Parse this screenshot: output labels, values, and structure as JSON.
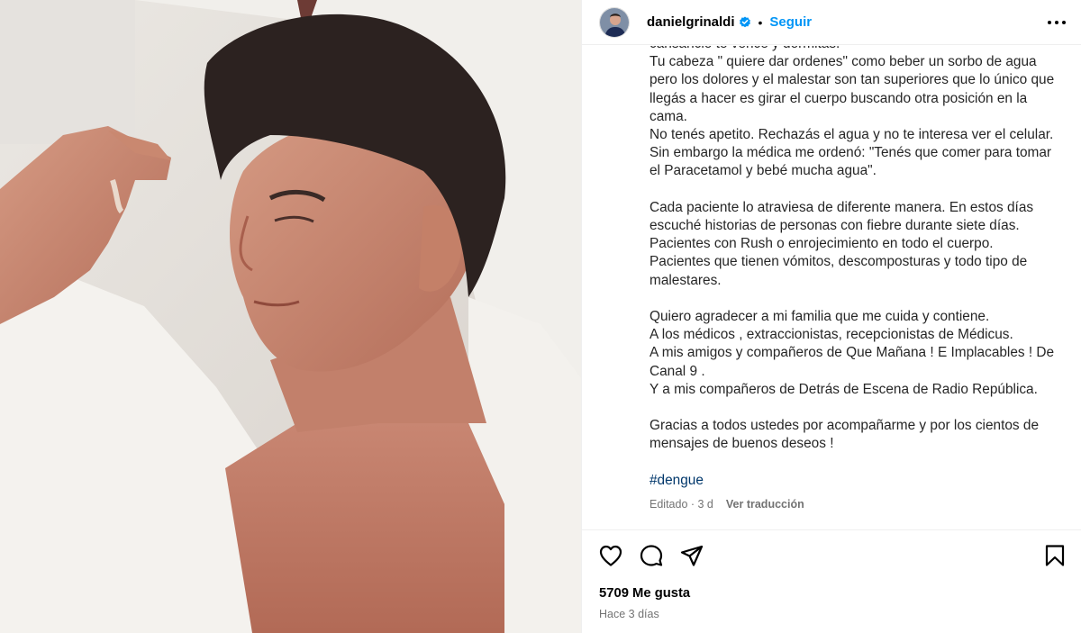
{
  "post": {
    "username": "danielgrinaldi",
    "follow_label": "Seguir",
    "separator": "•",
    "icons": {
      "verified": "verified-badge-icon",
      "more": "more-options-icon",
      "like": "heart-icon",
      "comment": "comment-icon",
      "share": "share-icon",
      "save": "bookmark-icon"
    },
    "colors": {
      "accent": "#0095f6",
      "hashtag": "#00376b",
      "muted": "#737373"
    }
  },
  "caption": {
    "lines": [
      "cansancio te vence y dormitás.",
      "Tu cabeza \" quiere dar ordenes\" como beber un sorbo de agua pero los dolores y el malestar son tan superiores que lo único que llegás a hacer es girar el cuerpo buscando otra posición en la cama.",
      "No tenés apetito. Rechazás el agua y no te interesa ver el celular.",
      "Sin embargo la médica me ordenó: \"Tenés que comer para tomar el Paracetamol y bebé mucha agua\".",
      "",
      "Cada paciente lo atraviesa de diferente manera. En estos días escuché historias de personas con fiebre durante siete días.",
      "Pacientes con Rush o enrojecimiento en todo el cuerpo.",
      "Pacientes que tienen vómitos, descomposturas y todo tipo de malestares.",
      "",
      "Quiero agradecer a mi familia que me cuida y contiene.",
      "A los médicos , extraccionistas, recepcionistas de Médicus.",
      "A mis amigos y compañeros de Que Mañana ! E Implacables ! De Canal 9 .",
      "Y a mis compañeros de Detrás de Escena de Radio República.",
      "",
      "Gracias a todos ustedes por acompañarme y por los cientos de mensajes de buenos deseos !",
      ""
    ],
    "hashtag": "#dengue",
    "edited": "Editado · 3 d",
    "translate": "Ver traducción"
  },
  "footer": {
    "likes": "5709 Me gusta",
    "time": "Hace 3 días"
  }
}
